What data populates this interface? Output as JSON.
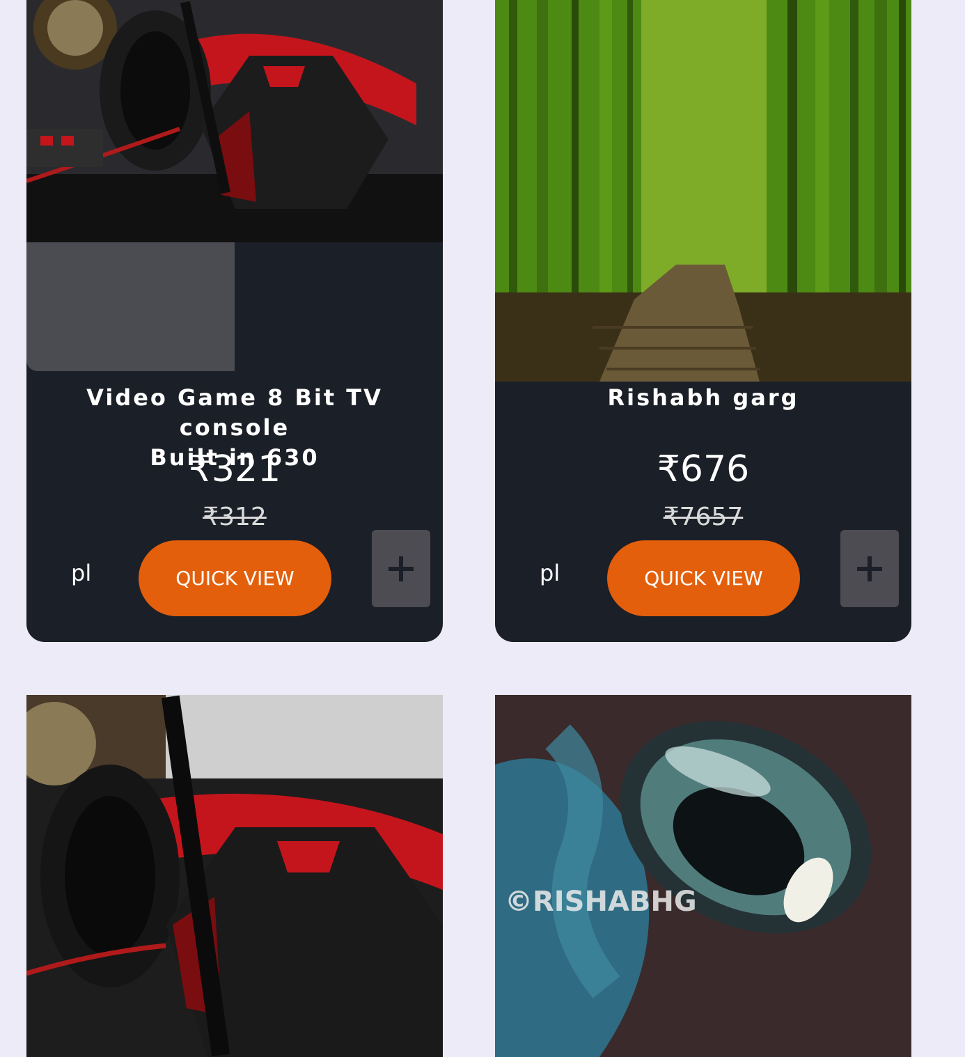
{
  "products": [
    {
      "image": "gaming-headphones-image",
      "title_line1": "Video Game 8 Bit TV console",
      "title_line2": "Built in 630",
      "price": "₹321",
      "old_price": "₹312",
      "tag": "pl",
      "quick_view_label": "QUICK VIEW",
      "add_icon": "plus-icon"
    },
    {
      "image": "bamboo-forest-image",
      "title": "Rishabh garg",
      "price": "₹676",
      "old_price": "₹7657",
      "tag": "pl",
      "quick_view_label": "QUICK VIEW",
      "add_icon": "plus-icon"
    },
    {
      "image": "gaming-headphones-image"
    },
    {
      "image": "water-drop-image",
      "watermark": "©RISHABHG"
    }
  ],
  "colors": {
    "page_background": "#ecebf7",
    "card_background": "#1b1f27",
    "quick_view": "#e35f0b",
    "add_button": "#4c4c52"
  }
}
